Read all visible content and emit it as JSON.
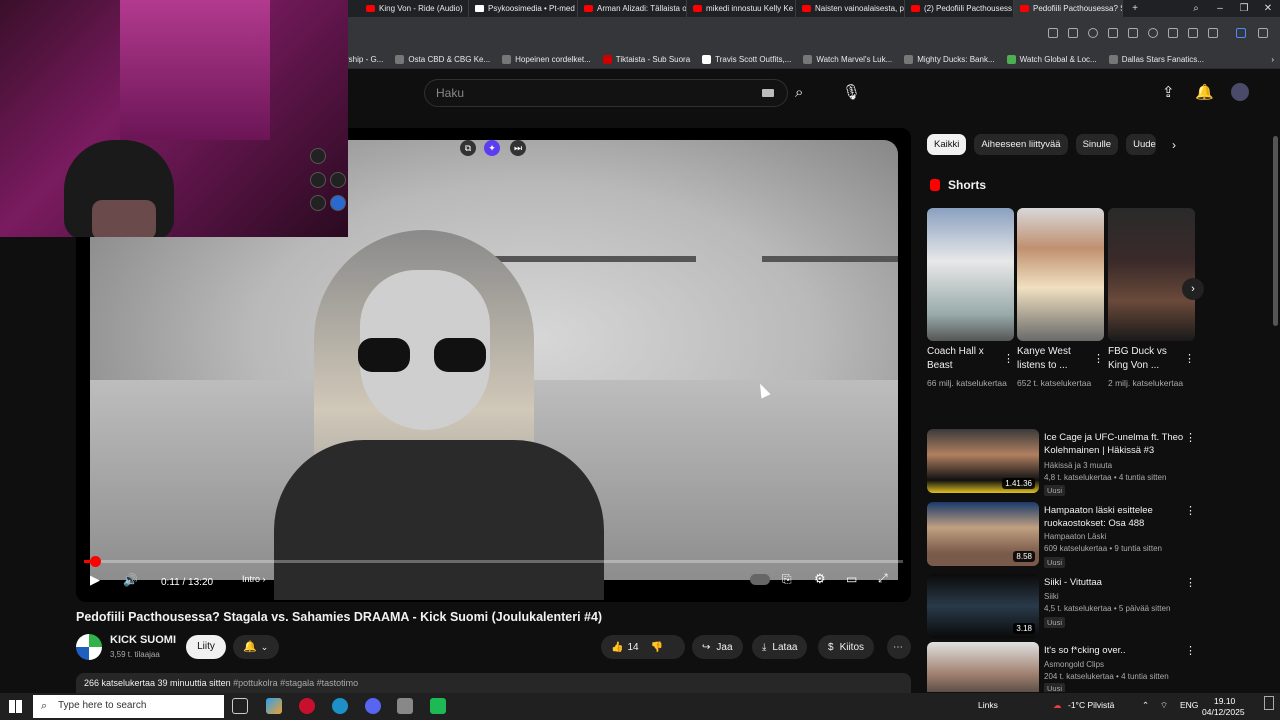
{
  "browser": {
    "tabs": [
      {
        "label": "King Von - Ride (Audio)",
        "icon": "youtube-icon"
      },
      {
        "label": "Psykoosimedia • Pt-med",
        "icon": "site-icon"
      },
      {
        "label": "Arman Alizadi: Tällaista o",
        "icon": "youtube-icon"
      },
      {
        "label": "mikedi innostuu Kelly Ke",
        "icon": "youtube-icon"
      },
      {
        "label": "Naisten vainoalaisesta, pe",
        "icon": "youtube-icon"
      },
      {
        "label": "(2) Pedofiili Pacthousess",
        "icon": "youtube-icon"
      },
      {
        "label": "Pedofiili Pacthousessa? St",
        "icon": "youtube-icon"
      }
    ],
    "new_tab": "+",
    "bookmarks": [
      "rship - G...",
      "Osta CBD & CBG Ke...",
      "Hopeinen cordelket...",
      "Tiktaista - Sub Suora",
      "Travis Scott Outfits,...",
      "Watch Marvel's Luk...",
      "Mighty Ducks: Bank...",
      "Watch Global & Loc...",
      "Dallas Stars Fanatics..."
    ]
  },
  "header": {
    "search_placeholder": "Haku"
  },
  "player": {
    "time": "0:11 / 13:20",
    "chapter": "Intro",
    "progress": 0.014
  },
  "video": {
    "title": "Pedofiili Pacthousessa? Stagala vs. Sahamies DRAAMA - Kick Suomi (Joulukalenteri #4)",
    "channel": "KICK SUOMI",
    "subscribers": "3,59 t. tilaajaa",
    "join_label": "Liity",
    "likes": "14",
    "share_label": "Jaa",
    "download_label": "Lataa",
    "thanks_label": "Kiitos",
    "views_time": "266 katselukertaa  39 minuuttia sitten",
    "tags": "#pottukolra #stagala #tastotimo"
  },
  "chips": [
    "Kaikki",
    "Aiheeseen liittyvää",
    "Sinulle",
    "Uude"
  ],
  "shorts": {
    "heading": "Shorts",
    "items": [
      {
        "title": "Coach Hall x Beast",
        "views": "66 milj. katselukertaa"
      },
      {
        "title": "Kanye West listens to ...",
        "views": "652 t. katselukertaa"
      },
      {
        "title": "FBG Duck vs King Von ...",
        "views": "2 milj. katselukertaa"
      }
    ]
  },
  "recommended": [
    {
      "title": "Ice Cage ja UFC-unelma ft. Theo Kolehmainen | Häkissä #3",
      "channel": "Häkissä ja 3 muuta",
      "meta": "4,8 t. katselukertaa • 4 tuntia sitten",
      "badge": "Uusi",
      "duration": "1.41.36"
    },
    {
      "title": "Hampaaton läski esittelee ruokaostokset: Osa 488",
      "channel": "Hampaaton Läski",
      "meta": "609 katselukertaa • 9 tuntia sitten",
      "badge": "Uusi",
      "duration": "8.58"
    },
    {
      "title": "Siiki - Vituttaa",
      "channel": "Siiki",
      "meta": "4,5 t. katselukertaa • 5 päivää sitten",
      "badge": "Uusi",
      "duration": "3.18"
    },
    {
      "title": "It's so f*cking over..",
      "channel": "Asmongold Clips",
      "meta": "204 t. katselukertaa • 4 tuntia sitten",
      "badge": "Uusi",
      "duration": ""
    }
  ],
  "taskbar": {
    "search_placeholder": "Type here to search",
    "links": "Links",
    "weather": "-1°C  Pilvistä",
    "language": "ENG",
    "time": "19.10",
    "date": "04/12/2025"
  },
  "colors": {
    "accent": "#ff0000",
    "background": "#0f0f0f",
    "chip": "#272727"
  }
}
